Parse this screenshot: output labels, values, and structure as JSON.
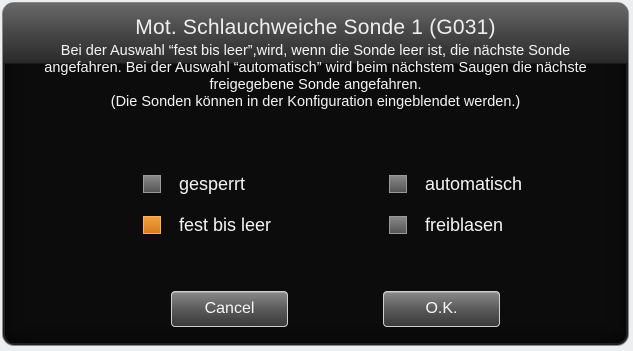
{
  "dialog": {
    "title": "Mot. Schlauchweiche Sonde 1 (G031)",
    "description_lines": [
      "Bei der Auswahl “fest bis leer”,wird,  wenn die Sonde leer ist, die nächste Sonde",
      "angefahren. Bei der Auswahl “automatisch” wird beim nächstem Saugen die nächste",
      "freigegebene Sonde angefahren.",
      "(Die Sonden können in der Konfiguration eingeblendet werden.)"
    ]
  },
  "options": [
    {
      "label": "gesperrt",
      "checked": false
    },
    {
      "label": "automatisch",
      "checked": false
    },
    {
      "label": "fest bis leer",
      "checked": true
    },
    {
      "label": "freiblasen",
      "checked": false
    }
  ],
  "buttons": {
    "cancel_label": "Cancel",
    "ok_label": "O.K."
  },
  "colors": {
    "checked": "#f0952f",
    "unchecked": "#6e6e6e",
    "background": "#0c0c0c",
    "text": "#f2f2f2"
  }
}
